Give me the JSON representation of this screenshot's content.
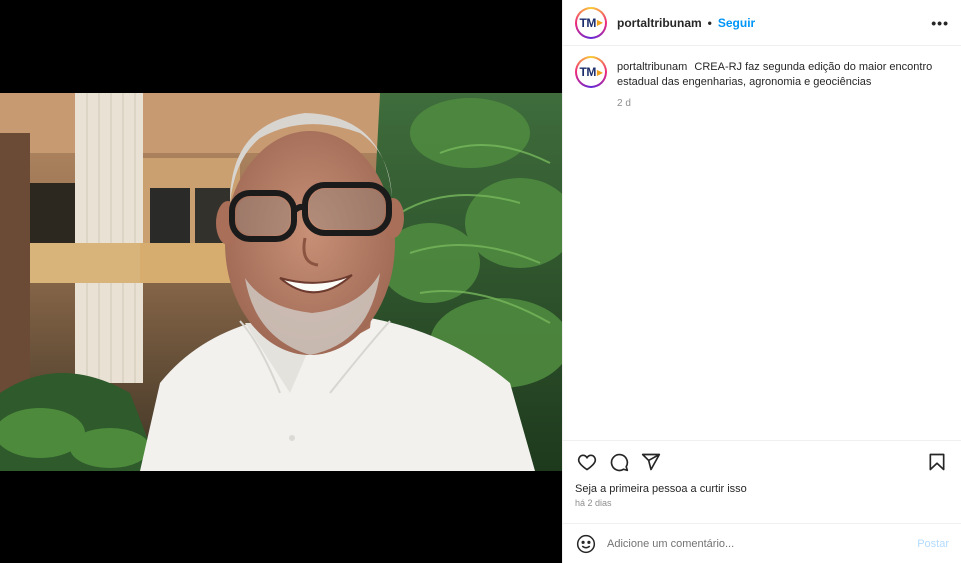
{
  "post": {
    "username": "portaltribunam",
    "follow_label": "Seguir",
    "separator": "•",
    "more_label": "•••",
    "avatar_text": "TM"
  },
  "caption": {
    "username": "portaltribunam",
    "text": "CREA-RJ faz segunda edição do maior encontro estadual das engenharias, agronomia e geociências",
    "time": "2 d"
  },
  "actions": {
    "likes_text": "Seja a primeira pessoa a curtir isso",
    "posted_ago": "há 2 dias"
  },
  "comment": {
    "placeholder": "Adicione um comentário...",
    "post_label": "Postar"
  },
  "colors": {
    "accent": "#0095f6",
    "post_disabled": "#b3dbff",
    "muted": "#8e8e8e"
  },
  "icons": [
    "heart-icon",
    "comment-icon",
    "share-icon",
    "bookmark-icon",
    "more-icon",
    "emoji-icon"
  ]
}
